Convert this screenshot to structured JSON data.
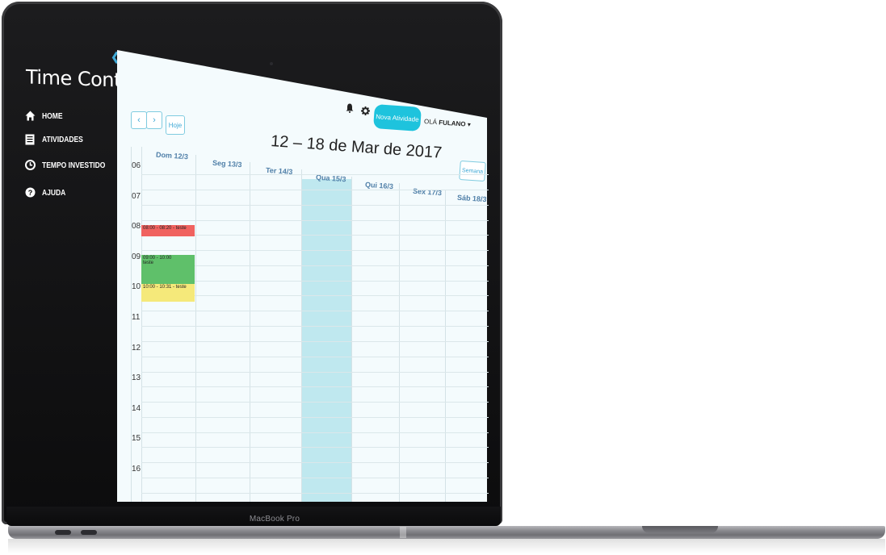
{
  "device": {
    "label": "MacBook Pro"
  },
  "sidebar": {
    "title": "Time Control",
    "items": [
      {
        "label": "HOME",
        "icon": "home-icon"
      },
      {
        "label": "ATIVIDADES",
        "icon": "list-icon"
      },
      {
        "label": "TEMPO INVESTIDO",
        "icon": "clock-icon"
      },
      {
        "label": "AJUDA",
        "icon": "help-icon"
      }
    ]
  },
  "toolbar": {
    "prev": "‹",
    "next": "›",
    "today": "Hoje",
    "new_activity": "Nova Atividade",
    "greeting_prefix": "OLÁ",
    "user": "FULANO",
    "view": "Semana"
  },
  "calendar": {
    "title": "12 – 18 de Mar de 2017",
    "days": [
      "Dom 12/3",
      "Seg 13/3",
      "Ter 14/3",
      "Qua 15/3",
      "Qui 16/3",
      "Sex 17/3",
      "Sáb 18/3"
    ],
    "hours": [
      "06",
      "07",
      "08",
      "09",
      "10",
      "11",
      "12",
      "13",
      "14",
      "15",
      "16"
    ],
    "events": [
      {
        "time": "08:00 - 08:20",
        "title": "teste",
        "color": "#f0625f"
      },
      {
        "time": "09:00 - 10:00",
        "title": "teste",
        "color": "#5fc06a"
      },
      {
        "time": "10:00 - 10:31",
        "title": "teste",
        "color": "#f5e97a"
      }
    ]
  },
  "colors": {
    "accent": "#1ec3dd",
    "today": "#bfe8ef",
    "sidebar": "#000000"
  }
}
